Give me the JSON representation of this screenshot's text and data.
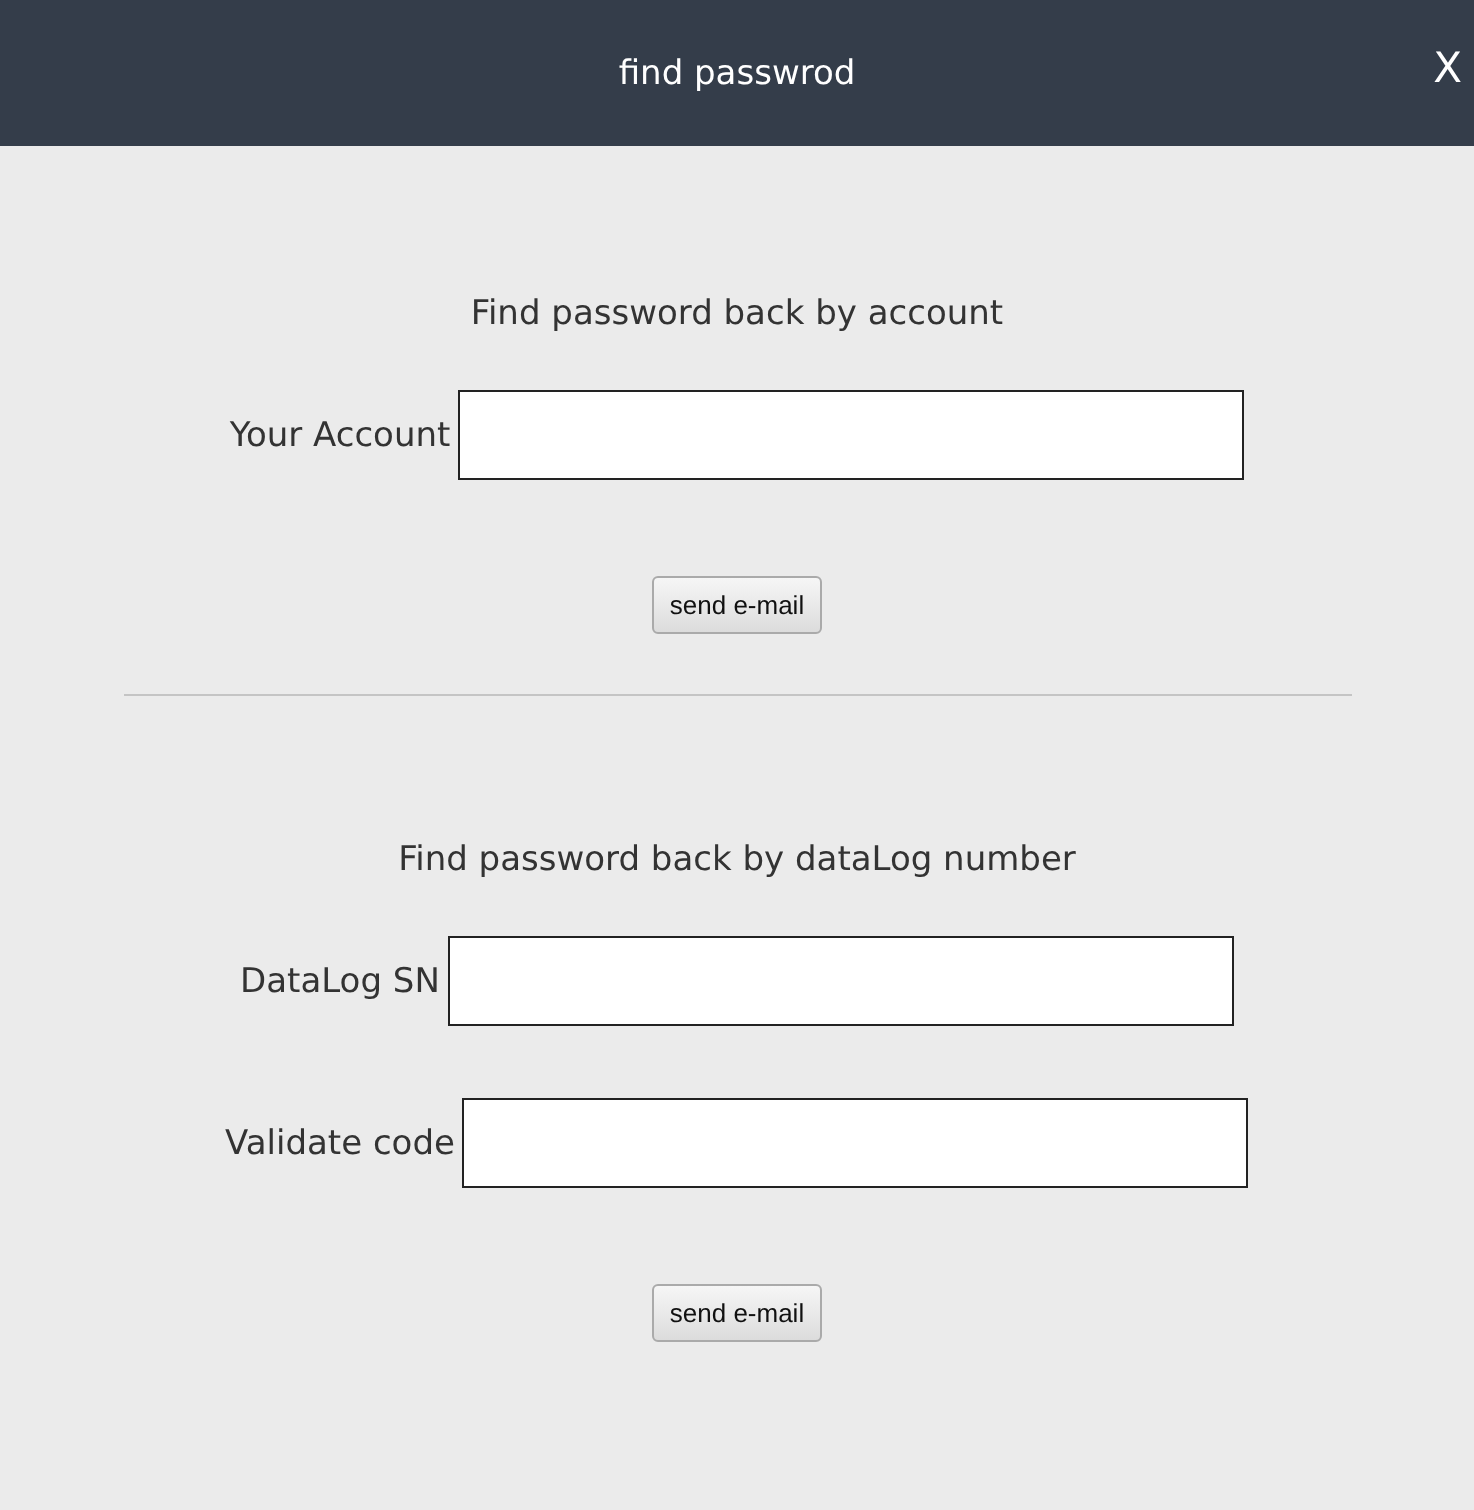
{
  "window": {
    "title": "find passwrod",
    "close": "X"
  },
  "sections": [
    {
      "heading": "Find password back by account",
      "fields": [
        {
          "label": "Your Account"
        }
      ],
      "button": "send e-mail"
    },
    {
      "heading": "Find password back by dataLog number",
      "fields": [
        {
          "label": "DataLog SN"
        },
        {
          "label": "Validate code"
        }
      ],
      "button": "send e-mail"
    }
  ]
}
